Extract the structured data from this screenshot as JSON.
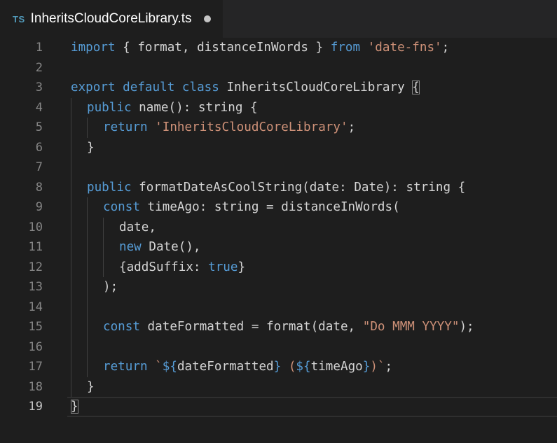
{
  "tab": {
    "icon": "TS",
    "filename": "InheritsCloudCoreLibrary.ts",
    "dirty_indicator": "dot-icon"
  },
  "editor": {
    "current_line": 19,
    "lines": [
      {
        "num": "1",
        "indent": 0,
        "tokens": [
          [
            "kw",
            "import"
          ],
          [
            "id",
            " { format, distanceInWords } "
          ],
          [
            "kw",
            "from"
          ],
          [
            "id",
            " "
          ],
          [
            "str",
            "'date-fns'"
          ],
          [
            "id",
            ";"
          ]
        ]
      },
      {
        "num": "2",
        "indent": 0,
        "tokens": []
      },
      {
        "num": "3",
        "indent": 0,
        "tokens": [
          [
            "kw",
            "export"
          ],
          [
            "id",
            " "
          ],
          [
            "kw",
            "default"
          ],
          [
            "id",
            " "
          ],
          [
            "kw",
            "class"
          ],
          [
            "id",
            " InheritsCloudCoreLibrary "
          ],
          [
            "brk",
            "{"
          ]
        ]
      },
      {
        "num": "4",
        "indent": 1,
        "tokens": [
          [
            "kw",
            "public"
          ],
          [
            "id",
            " name(): string {"
          ]
        ]
      },
      {
        "num": "5",
        "indent": 2,
        "tokens": [
          [
            "kw",
            "return"
          ],
          [
            "id",
            " "
          ],
          [
            "str",
            "'InheritsCloudCoreLibrary'"
          ],
          [
            "id",
            ";"
          ]
        ]
      },
      {
        "num": "6",
        "indent": 1,
        "tokens": [
          [
            "id",
            "}"
          ]
        ]
      },
      {
        "num": "7",
        "indent": 1,
        "tokens": []
      },
      {
        "num": "8",
        "indent": 1,
        "tokens": [
          [
            "kw",
            "public"
          ],
          [
            "id",
            " formatDateAsCoolString(date: Date): string {"
          ]
        ]
      },
      {
        "num": "9",
        "indent": 2,
        "tokens": [
          [
            "kw",
            "const"
          ],
          [
            "id",
            " timeAgo: string = distanceInWords("
          ]
        ]
      },
      {
        "num": "10",
        "indent": 3,
        "tokens": [
          [
            "id",
            "date,"
          ]
        ]
      },
      {
        "num": "11",
        "indent": 3,
        "tokens": [
          [
            "kw",
            "new"
          ],
          [
            "id",
            " Date(),"
          ]
        ]
      },
      {
        "num": "12",
        "indent": 3,
        "tokens": [
          [
            "id",
            "{addSuffix: "
          ],
          [
            "kw",
            "true"
          ],
          [
            "id",
            "}"
          ]
        ]
      },
      {
        "num": "13",
        "indent": 2,
        "tokens": [
          [
            "id",
            ");"
          ]
        ]
      },
      {
        "num": "14",
        "indent": 2,
        "tokens": []
      },
      {
        "num": "15",
        "indent": 2,
        "tokens": [
          [
            "kw",
            "const"
          ],
          [
            "id",
            " dateFormatted = format(date, "
          ],
          [
            "str",
            "\"Do MMM YYYY\""
          ],
          [
            "id",
            ");"
          ]
        ]
      },
      {
        "num": "16",
        "indent": 2,
        "tokens": []
      },
      {
        "num": "17",
        "indent": 2,
        "tokens": [
          [
            "kw",
            "return"
          ],
          [
            "id",
            " "
          ],
          [
            "str",
            "`"
          ],
          [
            "kw",
            "${"
          ],
          [
            "id",
            "dateFormatted"
          ],
          [
            "kw",
            "}"
          ],
          [
            "str",
            " ("
          ],
          [
            "kw",
            "${"
          ],
          [
            "id",
            "timeAgo"
          ],
          [
            "kw",
            "}"
          ],
          [
            "str",
            ")`"
          ],
          [
            "id",
            ";"
          ]
        ]
      },
      {
        "num": "18",
        "indent": 1,
        "tokens": [
          [
            "id",
            "}"
          ]
        ]
      },
      {
        "num": "19",
        "indent": 0,
        "tokens": [
          [
            "brk",
            "}"
          ]
        ]
      }
    ]
  }
}
